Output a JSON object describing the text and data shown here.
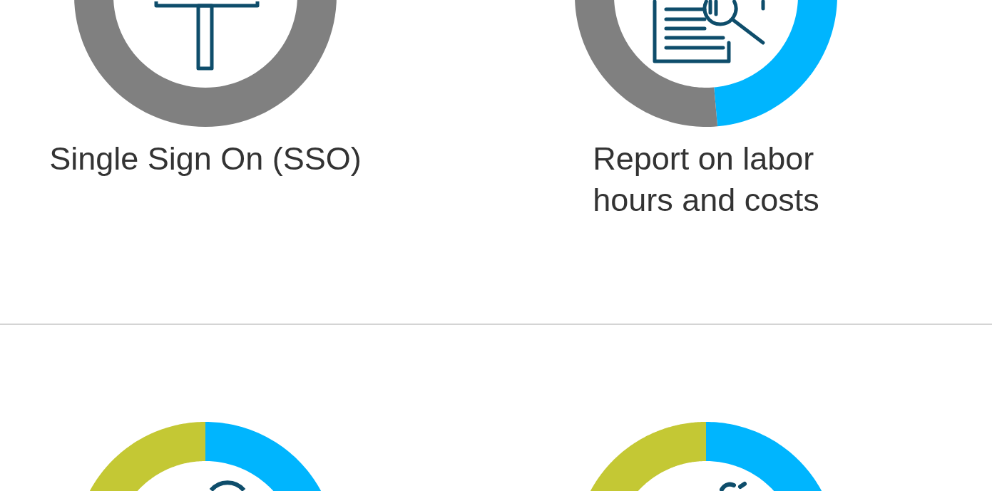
{
  "features": [
    {
      "label": "Single Sign On (SSO)"
    },
    {
      "label": "Report on labor\nhours and costs"
    }
  ]
}
